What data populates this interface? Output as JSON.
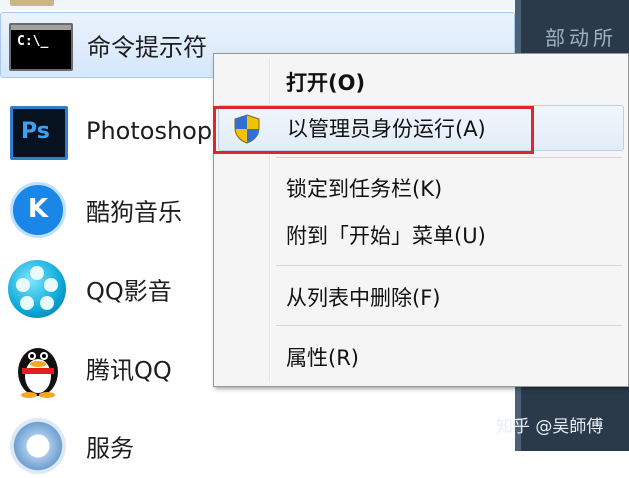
{
  "start_menu": {
    "items": [
      {
        "label": "命令提示符",
        "icon": "cmd-icon"
      },
      {
        "label": "Photoshop",
        "icon": "photoshop-icon"
      },
      {
        "label": "酷狗音乐",
        "icon": "kugou-icon"
      },
      {
        "label": "QQ影音",
        "icon": "qqvideo-icon"
      },
      {
        "label": "腾讯QQ",
        "icon": "qq-penguin-icon"
      },
      {
        "label": "服务",
        "icon": "gear-icon"
      }
    ],
    "cmd_icon_text": "C:\\_",
    "ps_icon_text": "Ps",
    "kugou_icon_text": "K"
  },
  "context_menu": {
    "open": "打开(O)",
    "run_as_admin": "以管理员身份运行(A)",
    "pin_taskbar": "锁定到任务栏(K)",
    "pin_start": "附到「开始」菜单(U)",
    "remove_from_list": "从列表中删除(F)",
    "properties": "属性(R)"
  },
  "right_panel": {
    "top_text": "部动所"
  },
  "watermark": "知乎 @吴師傅",
  "colors": {
    "highlight_border": "#e0262a",
    "taskbar_dark": "#2a3a4a",
    "hover_blue": "#d5e7fb"
  }
}
